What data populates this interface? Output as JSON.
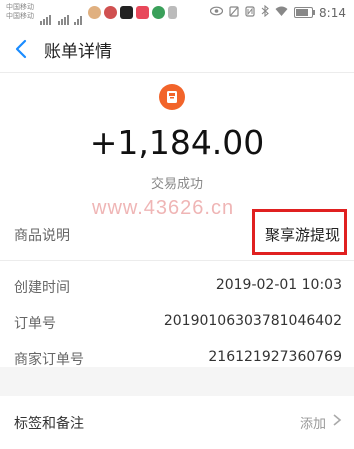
{
  "status_bar": {
    "carrier_1": "中国移动",
    "carrier_2": "中国移动",
    "time": "8:14"
  },
  "nav": {
    "title": "账单详情"
  },
  "summary": {
    "amount": "+1,184.00",
    "status": "交易成功"
  },
  "watermark": "www.43626.cn",
  "details": {
    "product_label": "商品说明",
    "product_value": "聚享游提现",
    "created_label": "创建时间",
    "created_value": "2019-02-01 10:03",
    "order_label": "订单号",
    "order_value": "20190106303781046402",
    "merchant_order_label": "商家订单号",
    "merchant_order_value": "216121927360769"
  },
  "tags": {
    "label": "标签和备注",
    "action": "添加"
  },
  "colors": {
    "accent": "#1a8cff",
    "merchant_icon": "#f2642a",
    "highlight": "#e02020"
  }
}
